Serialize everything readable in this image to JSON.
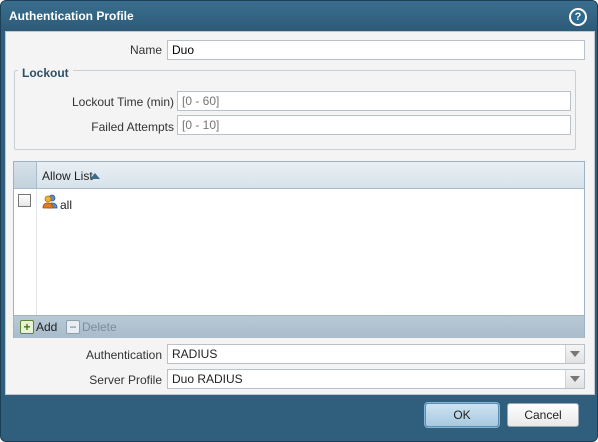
{
  "dialog": {
    "title": "Authentication Profile",
    "help_icon": "help-circle-icon"
  },
  "name_field": {
    "label": "Name",
    "value": "Duo"
  },
  "lockout": {
    "legend": "Lockout",
    "lockout_time": {
      "label": "Lockout Time (min)",
      "placeholder": "[0 - 60]"
    },
    "failed_attempts": {
      "label": "Failed Attempts",
      "placeholder": "[0 - 10]"
    }
  },
  "allow_list": {
    "column_header": "Allow List",
    "sort": "ascending",
    "rows": [
      {
        "icon": "user-group-icon",
        "value": "all",
        "checked": false
      }
    ],
    "toolbar": {
      "add_label": "Add",
      "delete_label": "Delete",
      "delete_enabled": false
    }
  },
  "authentication": {
    "label": "Authentication",
    "value": "RADIUS"
  },
  "server_profile": {
    "label": "Server Profile",
    "value": "Duo RADIUS"
  },
  "buttons": {
    "ok": "OK",
    "cancel": "Cancel"
  },
  "colors": {
    "titlebar": "#2f5f7c",
    "grid_footer": "#a9bccb",
    "ok_button": "#a8c9e0"
  }
}
